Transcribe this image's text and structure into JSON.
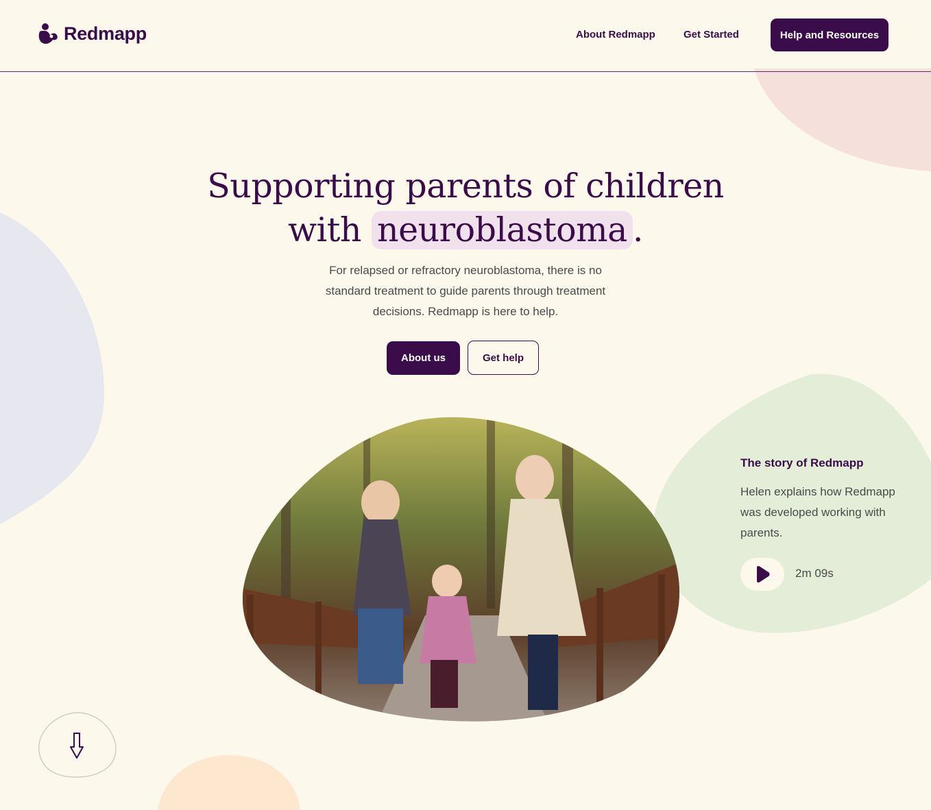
{
  "brand": {
    "name": "Redmapp",
    "accent": "#3a0d4a",
    "background": "#fcf8ec"
  },
  "nav": {
    "links": [
      {
        "label": "About Redmapp"
      },
      {
        "label": "Get Started"
      }
    ],
    "cta_label": "Help and Resources"
  },
  "hero": {
    "title_line1": "Supporting parents of children",
    "title_line2_prefix": "with",
    "title_highlight": "neuroblastoma",
    "title_suffix": ".",
    "subtitle": "For relapsed or refractory neuroblastoma, there is no standard treatment to guide parents through treatment decisions. Redmapp is here to help.",
    "primary_button": "About us",
    "secondary_button": "Get help"
  },
  "story": {
    "title": "The story of Redmapp",
    "body": "Helen explains how Redmapp was developed working with parents.",
    "duration": "2m 09s",
    "play_icon": "play-icon"
  },
  "decor": {
    "blob_colors": {
      "pink": "#f6e0dc",
      "lavender": "#e7e8ef",
      "green": "#e4edd8",
      "peach": "#fde7cf"
    }
  },
  "scroll": {
    "icon": "arrow-down-icon"
  }
}
